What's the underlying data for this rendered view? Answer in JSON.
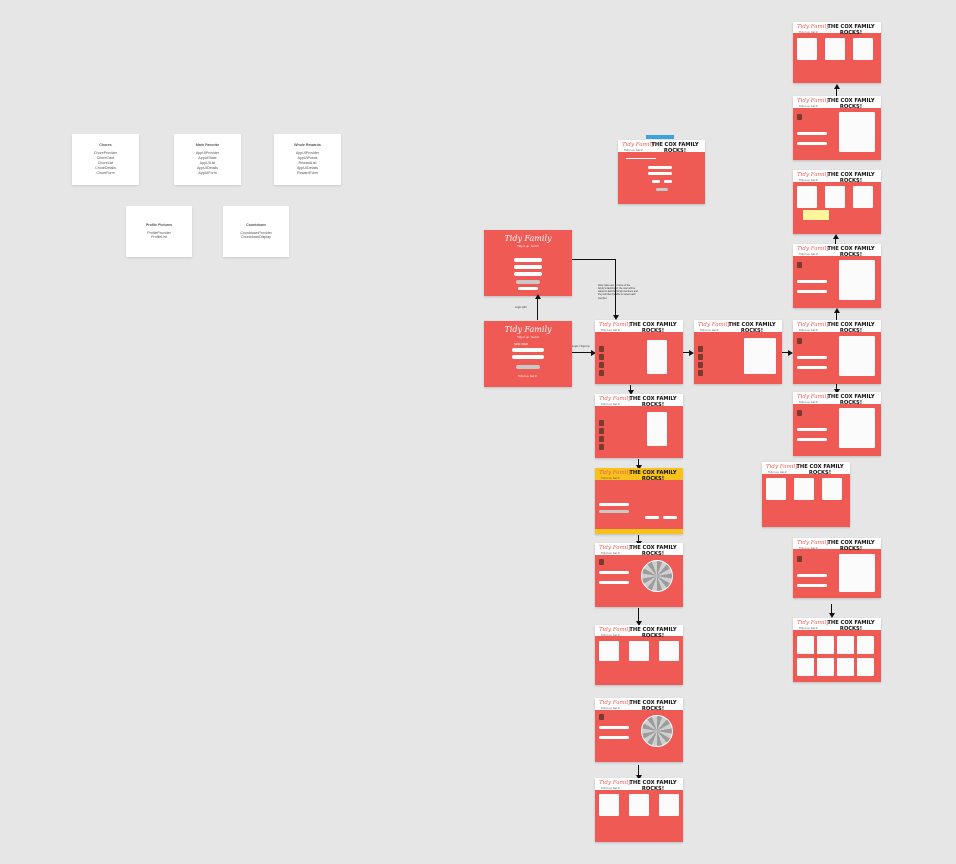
{
  "notes": [
    {
      "title": "Chores",
      "lines": [
        "ChoreProvider",
        "ChoreCard",
        "ChoreList",
        "ChoreDetails",
        "ChoreForm"
      ]
    },
    {
      "title": "Main Favorite",
      "lines": [
        "AppUIProvider",
        "AppUIState",
        "AppUIList",
        "AppUIDetails",
        "AppUIForm"
      ]
    },
    {
      "title": "Whole Rewards",
      "lines": [
        "AppUIProvider",
        "AppUIPoints",
        "RewardList",
        "AppUIDetails",
        "RewardForm"
      ]
    },
    {
      "title": "Profile Pictures",
      "lines": [
        "ProfileProvider",
        "ProfileList"
      ]
    },
    {
      "title": "Countdown",
      "lines": [
        "CountdownProvider",
        "CountdownDisplay"
      ]
    }
  ],
  "brand": {
    "name": "Tidy Family",
    "tagline": "Tidy it up. Get it!"
  },
  "family_title": "THE COX FAMILY ROCKS!",
  "frames_count": 21,
  "annotations": {
    "login_to_home": "Login / Sign Up",
    "login_arrow": "Login with",
    "new_user": "NEW USER",
    "side_note": "Note: take user to home of the family's dashboard; the user will be asked to add the family members and they will then be able to select each member"
  }
}
